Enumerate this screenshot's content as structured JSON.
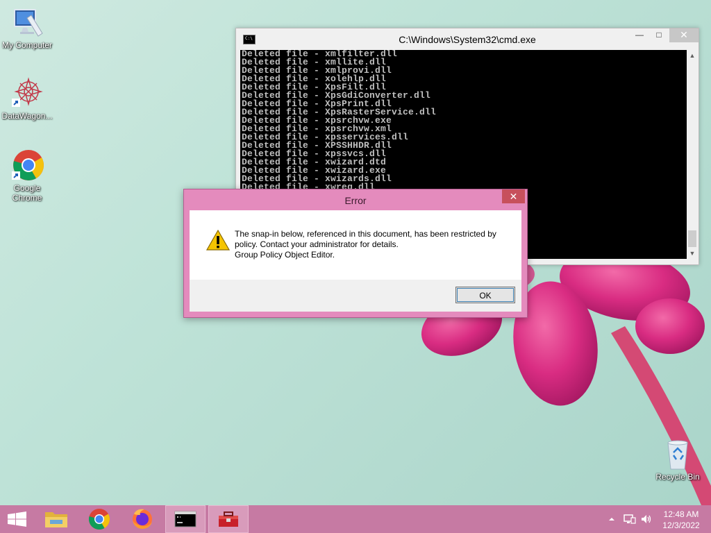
{
  "desktop": {
    "icons": [
      {
        "label": "My Computer",
        "icon": "computer-icon"
      },
      {
        "label": "DataWagon...",
        "icon": "datawagon-icon"
      },
      {
        "label": "Google Chrome",
        "icon": "chrome-icon"
      },
      {
        "label": "Recycle Bin",
        "icon": "recycle-bin-icon"
      }
    ]
  },
  "cmd_window": {
    "title": "C:\\Windows\\System32\\cmd.exe",
    "lines": [
      "Deleted file - xmlfilter.dll",
      "Deleted file - xmllite.dll",
      "Deleted file - xmlprovi.dll",
      "Deleted file - xolehlp.dll",
      "Deleted file - XpsFilt.dll",
      "Deleted file - XpsGdiConverter.dll",
      "Deleted file - XpsPrint.dll",
      "Deleted file - XpsRasterService.dll",
      "Deleted file - xpsrchvw.exe",
      "Deleted file - xpsrchvw.xml",
      "Deleted file - xpsservices.dll",
      "Deleted file - XPSSHHDR.dll",
      "Deleted file - xpssvcs.dll",
      "Deleted file - xwizard.dtd",
      "Deleted file - xwizard.exe",
      "Deleted file - xwizards.dll",
      "Deleted file - xwreg.dll"
    ],
    "min_glyph": "—",
    "max_glyph": "□",
    "close_glyph": "✕"
  },
  "error_dialog": {
    "title": "Error",
    "message_lines": [
      "The snap-in below, referenced in this document, has been restricted by",
      "policy. Contact your administrator for details.",
      "Group Policy Object Editor."
    ],
    "ok_label": "OK",
    "close_glyph": "✕"
  },
  "taskbar": {
    "items": [
      "start-button",
      "file-explorer",
      "chrome",
      "firefox",
      "cmd",
      "toolbox"
    ],
    "clock_time": "12:48 AM",
    "clock_date": "12/3/2022"
  },
  "colors": {
    "taskbar": "#c67aa3",
    "dialog_frame": "#e48bbd",
    "close_button": "#c7505c"
  }
}
